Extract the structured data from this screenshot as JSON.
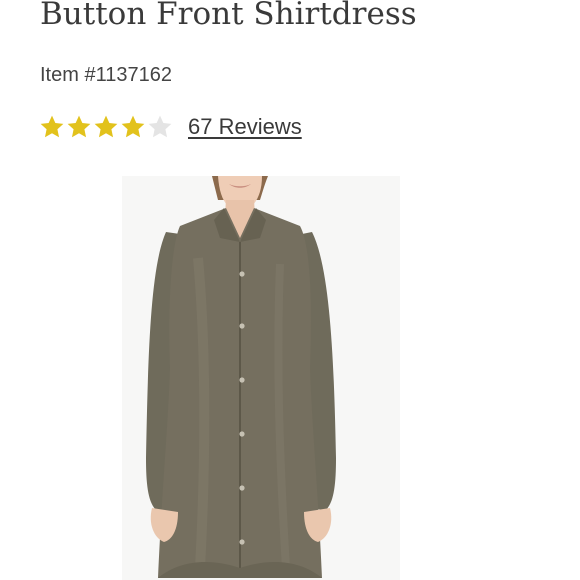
{
  "product": {
    "title": "Button Front Shirtdress",
    "item_number": "Item #1137162"
  },
  "rating": {
    "value": 4,
    "max": 5,
    "star_icon": "star-icon",
    "filled_color": "#e2c21c",
    "empty_color": "#e4e4e4",
    "reviews_label": "67 Reviews"
  },
  "image": {
    "subject": "olive-shirtdress-photo",
    "dress_color": "#736f5f",
    "background_color": "#ffffff"
  }
}
